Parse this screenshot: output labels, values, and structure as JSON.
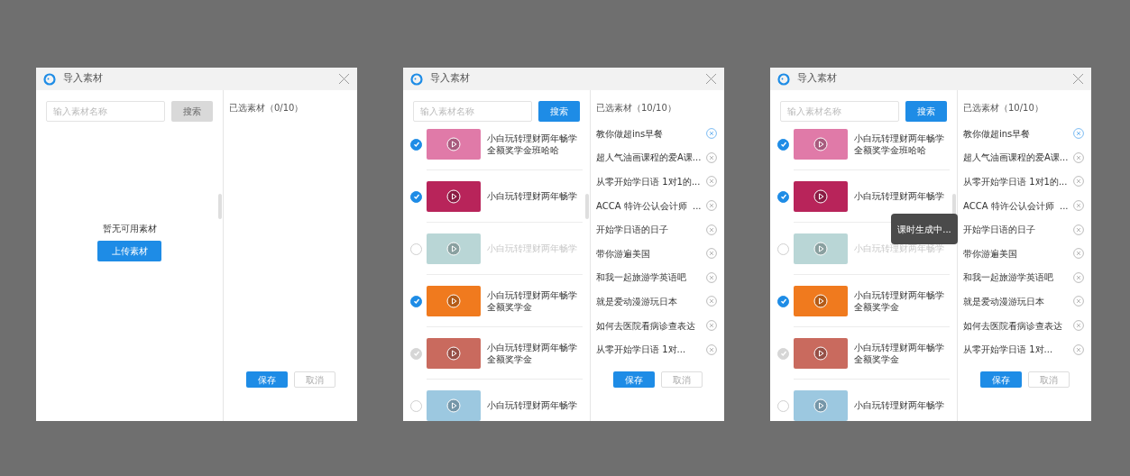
{
  "dialogs": [
    {
      "title": "导入素材",
      "search": {
        "placeholder": "输入素材名称",
        "button": "搜索",
        "disabled": true
      },
      "empty": {
        "message": "暂无可用素材",
        "button": "上传素材"
      },
      "selected": {
        "heading": "已选素材（0/10）"
      },
      "buttons": [
        "保存",
        "取消"
      ]
    },
    {
      "title": "导入素材",
      "search": {
        "placeholder": "输入素材名称",
        "button": "搜索",
        "disabled": false
      },
      "materials": [
        {
          "title": "小白玩转理财两年畅学全额奖学金班哈哈",
          "checked": true,
          "disabled": false,
          "dimmed": false,
          "color": "#e07aa8"
        },
        {
          "title": "小白玩转理财两年畅学",
          "checked": true,
          "disabled": false,
          "dimmed": false,
          "color": "#b8245a"
        },
        {
          "title": "小白玩转理财两年畅学",
          "checked": false,
          "disabled": false,
          "dimmed": true,
          "color": "#b9d6d6"
        },
        {
          "title": "小白玩转理财两年畅学全额奖学金",
          "checked": true,
          "disabled": false,
          "dimmed": false,
          "color": "#f07a1e"
        },
        {
          "title": "小白玩转理财两年畅学全额奖学金",
          "checked": true,
          "disabled": true,
          "dimmed": false,
          "color": "#c96a5e"
        },
        {
          "title": "小白玩转理财两年畅学",
          "checked": false,
          "disabled": false,
          "dimmed": false,
          "color": "#9cc8e0"
        }
      ],
      "selected": {
        "heading": "已选素材（10/10）",
        "items": [
          {
            "title": "教你做超ins早餐",
            "active": true
          },
          {
            "title": "超人气油画课程的爱A课...",
            "active": false
          },
          {
            "title": "从零开始学日语 1对1的...",
            "active": false
          },
          {
            "title": "ACCA 特许公认会计师  ...",
            "active": false
          },
          {
            "title": "开始学日语的日子",
            "active": false
          },
          {
            "title": "带你游遍美国",
            "active": false
          },
          {
            "title": "和我一起旅游学英语吧",
            "active": false
          },
          {
            "title": "就是爱动漫游玩日本",
            "active": false
          },
          {
            "title": "如何去医院看病诊查表达",
            "active": false
          },
          {
            "title": "从零开始学日语 1对...",
            "active": false
          }
        ]
      },
      "buttons": [
        "保存",
        "取消"
      ]
    },
    {
      "title": "导入素材",
      "search": {
        "placeholder": "输入素材名称",
        "button": "搜索",
        "disabled": false
      },
      "materials": [
        {
          "title": "小白玩转理财两年畅学全额奖学金班哈哈",
          "checked": true,
          "disabled": false,
          "dimmed": false,
          "color": "#e07aa8"
        },
        {
          "title": "小白玩转理财两年畅学",
          "checked": true,
          "disabled": false,
          "dimmed": false,
          "color": "#b8245a"
        },
        {
          "title": "小白玩转理财两年畅学",
          "checked": false,
          "disabled": false,
          "dimmed": true,
          "color": "#b9d6d6"
        },
        {
          "title": "小白玩转理财两年畅学全额奖学金",
          "checked": true,
          "disabled": false,
          "dimmed": false,
          "color": "#f07a1e"
        },
        {
          "title": "小白玩转理财两年畅学全额奖学金",
          "checked": true,
          "disabled": true,
          "dimmed": false,
          "color": "#c96a5e"
        },
        {
          "title": "小白玩转理财两年畅学",
          "checked": false,
          "disabled": false,
          "dimmed": false,
          "color": "#9cc8e0"
        }
      ],
      "selected": {
        "heading": "已选素材（10/10）",
        "items": [
          {
            "title": "教你做超ins早餐",
            "active": true
          },
          {
            "title": "超人气油画课程的爱A课...",
            "active": false
          },
          {
            "title": "从零开始学日语 1对1的...",
            "active": false
          },
          {
            "title": "ACCA 特许公认会计师  ...",
            "active": false
          },
          {
            "title": "开始学日语的日子",
            "active": false
          },
          {
            "title": "带你游遍美国",
            "active": false
          },
          {
            "title": "和我一起旅游学英语吧",
            "active": false
          },
          {
            "title": "就是爱动漫游玩日本",
            "active": false
          },
          {
            "title": "如何去医院看病诊查表达",
            "active": false
          },
          {
            "title": "从零开始学日语 1对...",
            "active": false
          }
        ]
      },
      "buttons": [
        "保存",
        "取消"
      ],
      "toast": "课时生成中..."
    }
  ]
}
